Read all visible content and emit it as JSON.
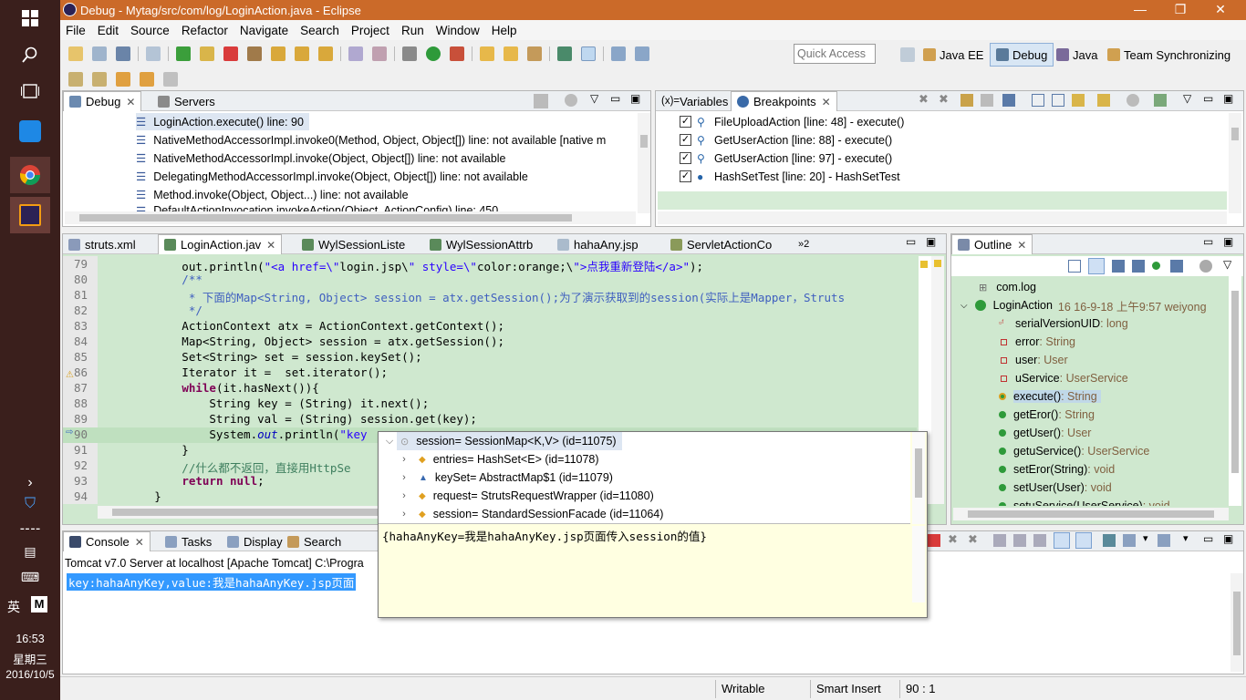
{
  "taskbar": {
    "lang": "英",
    "ime": "M",
    "time": "16:53",
    "weekday": "星期三",
    "date": "2016/10/5"
  },
  "window": {
    "title": "Debug - Mytag/src/com/log/LoginAction.java - Eclipse"
  },
  "menu": [
    "File",
    "Edit",
    "Source",
    "Refactor",
    "Navigate",
    "Search",
    "Project",
    "Run",
    "Window",
    "Help"
  ],
  "quick_access": {
    "placeholder": "Quick Access"
  },
  "perspectives": [
    "Java EE",
    "Debug",
    "Java",
    "Team Synchronizing"
  ],
  "debug_panel": {
    "tabs": [
      "Debug",
      "Servers"
    ],
    "frames": [
      "LoginAction.execute() line: 90",
      "NativeMethodAccessorImpl.invoke0(Method, Object, Object[]) line: not available [native m",
      "NativeMethodAccessorImpl.invoke(Object, Object[]) line: not available",
      "DelegatingMethodAccessorImpl.invoke(Object, Object[]) line: not available",
      "Method.invoke(Object, Object...) line: not available",
      "DefaultActionInvocation.invokeAction(Object, ActionConfig) line: 450"
    ]
  },
  "breakpoints_panel": {
    "tabs": [
      "Variables",
      "Breakpoints"
    ],
    "prefix": "(x)=",
    "items": [
      "FileUploadAction [line: 48] - execute()",
      "GetUserAction [line: 88] - execute()",
      "GetUserAction [line: 97] - execute()",
      "HashSetTest [line: 20] - HashSetTest"
    ]
  },
  "editor": {
    "tabs": [
      "struts.xml",
      "LoginAction.jav",
      "WylSessionListe",
      "WylSessionAttrb",
      "hahaAny.jsp",
      "ServletActionCo"
    ],
    "overflow": "»2",
    "lines": [
      {
        "n": "79",
        "t": "            out.println(\"<a href=\\\"login.jsp\\\" style=\\\"color:orange;\\\">点我重新登陆</a>\");"
      },
      {
        "n": "80",
        "t": "            /**"
      },
      {
        "n": "81",
        "t": "             * 下面的Map<String, Object> session = atx.getSession();为了演示获取到的session(实际上是Mapper，Struts"
      },
      {
        "n": "82",
        "t": "             */"
      },
      {
        "n": "83",
        "t": "            ActionContext atx = ActionContext.getContext();"
      },
      {
        "n": "84",
        "t": "            Map<String, Object> session = atx.getSession();"
      },
      {
        "n": "85",
        "t": "            Set<String> set = session.keySet();"
      },
      {
        "n": "86",
        "t": "            Iterator it =  set.iterator();"
      },
      {
        "n": "87",
        "t": "            while(it.hasNext()){"
      },
      {
        "n": "88",
        "t": "                String key = (String) it.next();"
      },
      {
        "n": "89",
        "t": "                String val = (String) session.get(key);"
      },
      {
        "n": "90",
        "t": "                System.out.println(\"key"
      },
      {
        "n": "91",
        "t": "            }"
      },
      {
        "n": "92",
        "t": "            //什么都不返回，直接用HttpSe"
      },
      {
        "n": "93",
        "t": "            return null;"
      },
      {
        "n": "94",
        "t": "        }"
      }
    ]
  },
  "outline": {
    "tab": "Outline",
    "pkg": "com.log",
    "cls": "LoginAction",
    "cls_meta": "16  16-9-18 上午9:57  weiyong",
    "members": [
      {
        "name": "serialVersionUID",
        "type": " : long",
        "kind": "sf"
      },
      {
        "name": "error",
        "type": " : String",
        "kind": "field"
      },
      {
        "name": "user",
        "type": " : User",
        "kind": "field"
      },
      {
        "name": "uService",
        "type": " : UserService",
        "kind": "field"
      },
      {
        "name": "execute()",
        "type": " : String",
        "kind": "exec"
      },
      {
        "name": "getEror()",
        "type": " : String",
        "kind": "method"
      },
      {
        "name": "getUser()",
        "type": " : User",
        "kind": "method"
      },
      {
        "name": "getuService()",
        "type": " : UserService",
        "kind": "method"
      },
      {
        "name": "setEror(String)",
        "type": " : void",
        "kind": "method"
      },
      {
        "name": "setUser(User)",
        "type": " : void",
        "kind": "method"
      },
      {
        "name": "setuService(UserService)",
        "type": " : void",
        "kind": "method"
      }
    ]
  },
  "console": {
    "tabs": [
      "Console",
      "Tasks",
      "Display",
      "Search"
    ],
    "server": "Tomcat v7.0 Server at localhost [Apache Tomcat] C:\\Progra",
    "output": "key:hahaAnyKey,value:我是hahaAnyKey.jsp页面"
  },
  "popup": {
    "rows": [
      {
        "label": "session= SessionMap<K,V>  (id=11075)",
        "kind": "root"
      },
      {
        "label": "entries= HashSet<E>  (id=11078)",
        "kind": "field"
      },
      {
        "label": "keySet= AbstractMap$1  (id=11079)",
        "kind": "tri"
      },
      {
        "label": "request= StrutsRequestWrapper  (id=11080)",
        "kind": "field"
      },
      {
        "label": "session= StandardSessionFacade  (id=11064)",
        "kind": "field"
      }
    ],
    "value": "{hahaAnyKey=我是hahaAnyKey.jsp页面传入session的值}"
  },
  "status": {
    "writable": "Writable",
    "insert": "Smart Insert",
    "position": "90 : 1"
  },
  "colors": {
    "title_bar": "#cb6a29",
    "taskbar": "#3a1f1c",
    "code_bg": "#cfe8cf",
    "current_line": "#bfe0bf",
    "popup_bg": "#ffffe1",
    "keyword": "#7f0055",
    "string": "#2a00ff"
  }
}
